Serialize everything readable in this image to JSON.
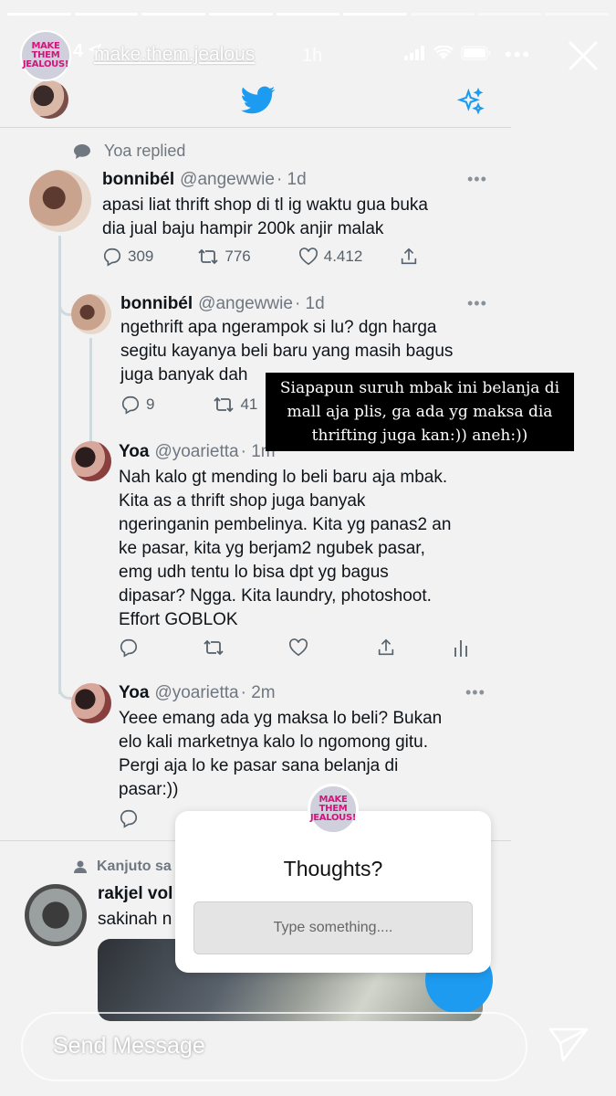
{
  "story": {
    "username": "make.them.jealous",
    "time_ago": "1h",
    "more_icon": "more-horizontal-icon",
    "close_icon": "close-icon",
    "status_time": "4",
    "logo_text": [
      "MAKE",
      "THEM",
      "JEALOUS!"
    ],
    "progress_segments": 9,
    "progress_done": 6
  },
  "caption": {
    "lines": [
      "Siapapun suruh mbak ini belanja di",
      "mall aja plis, ga ada yg maksa dia",
      "thrifting juga kan:)) aneh:))"
    ]
  },
  "twitter": {
    "replied_label": "Yoa replied",
    "tweets": [
      {
        "name": "bonnibél",
        "handle": "@angewwie",
        "time": "· 1d",
        "lines": [
          "apasi liat thrift shop di tl ig waktu gua buka",
          "dia jual baju hampir 200k anjir malak"
        ],
        "replies": "309",
        "retweets": "776",
        "likes": "4.412"
      },
      {
        "name": "bonnibél",
        "handle": "@angewwie",
        "time": "· 1d",
        "lines": [
          "ngethrift apa ngerampok si lu? dgn harga",
          "segitu kayanya beli baru yang masih bagus",
          "juga banyak dah"
        ],
        "replies": "9",
        "retweets": "41"
      },
      {
        "name": "Yoa",
        "handle": "@yoarietta",
        "time": "· 1m",
        "lines": [
          "Nah kalo gt mending lo beli baru aja mbak.",
          "Kita as a thrift shop juga banyak",
          "ngeringanin pembelinya. Kita yg panas2 an",
          "ke pasar, kita yg berjam2 ngubek pasar,",
          "emg udh tentu lo bisa dpt yg bagus",
          "dipasar? Ngga. Kita laundry, photoshoot.",
          "Effort GOBLOK"
        ]
      },
      {
        "name": "Yoa",
        "handle": "@yoarietta",
        "time": "· 2m",
        "lines": [
          "Yeee emang ada yg maksa lo beli? Bukan",
          "elo kali marketnya kalo lo ngomong gitu.",
          "Pergi aja lo ke pasar sana belanja di",
          "pasar:))"
        ]
      }
    ],
    "next_context": "Kanjuto sa",
    "next_name": "rakjel vol",
    "next_text": "sakinah n"
  },
  "question": {
    "title": "Thoughts?",
    "placeholder": "Type something...."
  },
  "reply_bar": {
    "label": "Send Message",
    "send_icon": "send-icon"
  }
}
